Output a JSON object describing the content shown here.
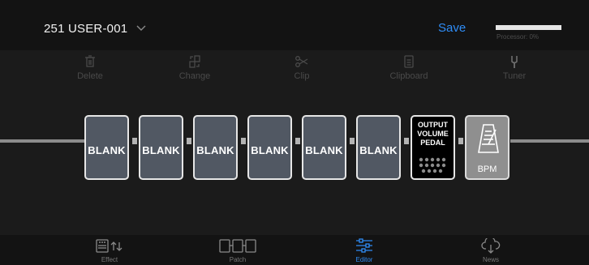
{
  "header": {
    "patch_name": "251 USER-001",
    "save_label": "Save",
    "processor_label": "Processor: 0%",
    "processor_percent": 0,
    "accent_color": "#2f8cf5"
  },
  "toolbar": {
    "items": [
      {
        "label": "Delete",
        "icon": "trash-icon"
      },
      {
        "label": "Change",
        "icon": "swap-icon"
      },
      {
        "label": "Clip",
        "icon": "scissors-icon"
      },
      {
        "label": "Clipboard",
        "icon": "clipboard-icon"
      },
      {
        "label": "Tuner",
        "icon": "tuning-fork-icon"
      }
    ]
  },
  "chain": {
    "blocks": [
      {
        "label": "BLANK"
      },
      {
        "label": "BLANK"
      },
      {
        "label": "BLANK"
      },
      {
        "label": "BLANK"
      },
      {
        "label": "BLANK"
      },
      {
        "label": "BLANK"
      }
    ],
    "volume_pedal": {
      "line1": "OUTPUT",
      "line2": "VOLUME",
      "line3": "PEDAL"
    },
    "bpm": {
      "label": "BPM",
      "icon": "metronome-icon"
    }
  },
  "nav": {
    "items": [
      {
        "label": "Effect",
        "icon": "effect-icon",
        "active": false
      },
      {
        "label": "Patch",
        "icon": "patch-icon",
        "active": false
      },
      {
        "label": "Editor",
        "icon": "sliders-icon",
        "active": true
      },
      {
        "label": "News",
        "icon": "cloud-download-icon",
        "active": false
      }
    ]
  }
}
